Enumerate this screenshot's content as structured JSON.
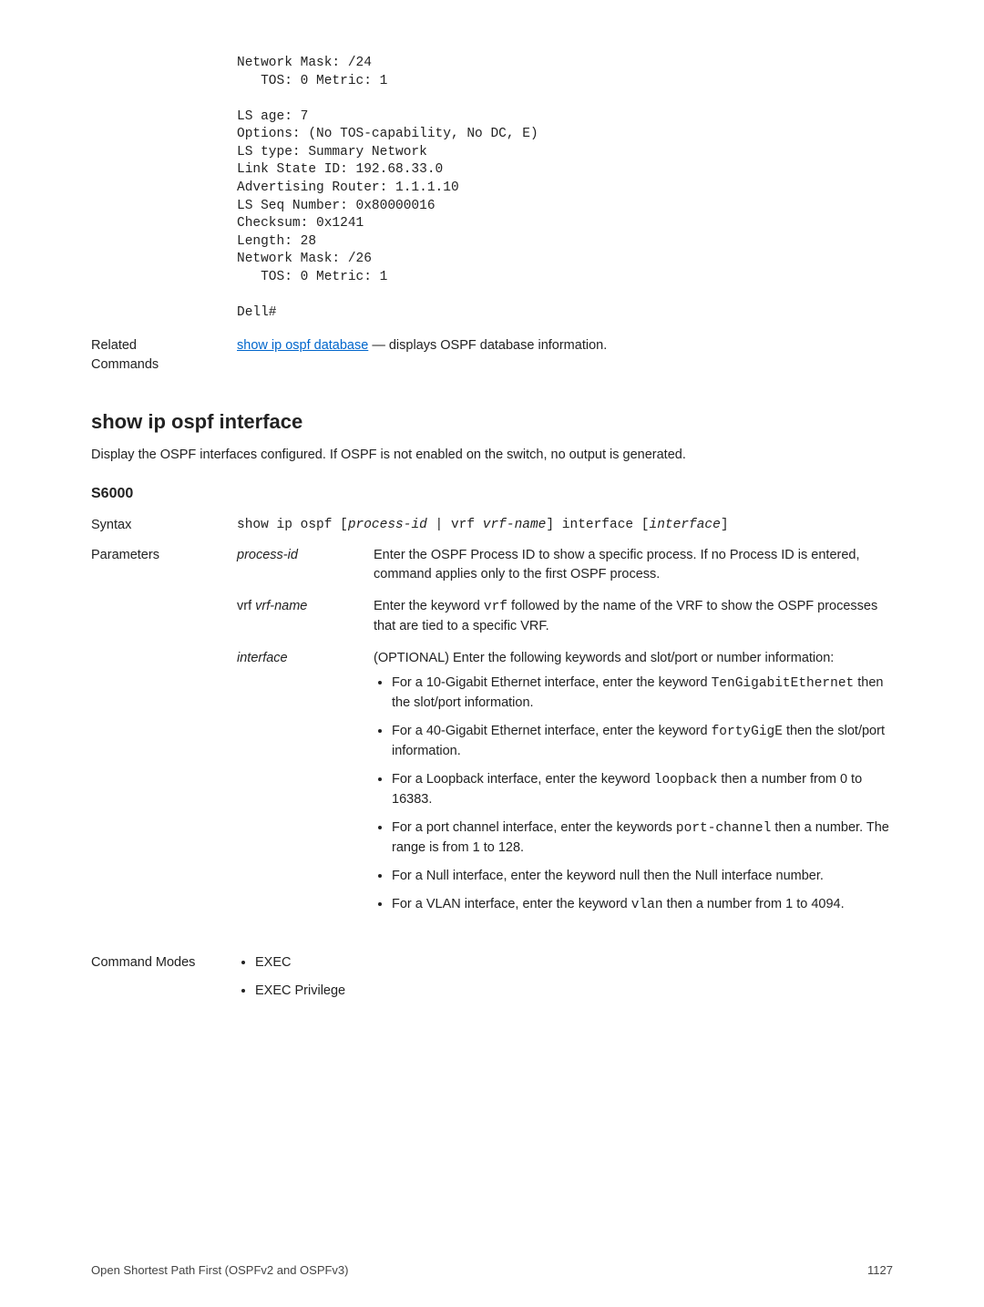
{
  "code_output": "Network Mask: /24\n   TOS: 0 Metric: 1\n\nLS age: 7\nOptions: (No TOS-capability, No DC, E)\nLS type: Summary Network\nLink State ID: 192.68.33.0\nAdvertising Router: 1.1.1.10\nLS Seq Number: 0x80000016\nChecksum: 0x1241\nLength: 28\nNetwork Mask: /26\n   TOS: 0 Metric: 1\n\nDell#",
  "related": {
    "label": "Related Commands",
    "link_text": "show ip ospf database",
    "after": " — displays OSPF database information."
  },
  "section": {
    "heading": "show ip ospf interface",
    "desc": "Display the OSPF interfaces configured. If OSPF is not enabled on the switch, no output is generated.",
    "model": "S6000"
  },
  "syntax": {
    "label": "Syntax",
    "pre": "show ip ospf [",
    "ital1": "process-id",
    "mid1": " | vrf ",
    "ital2": "vrf-name",
    "mid2": "] interface [",
    "ital3": "interface",
    "post": "]"
  },
  "params": {
    "label": "Parameters",
    "p1": {
      "name": "process-id",
      "desc": "Enter the OSPF Process ID to show a specific process. If no Process ID is entered, command applies only to the first OSPF process."
    },
    "p2": {
      "name_prefix": "vrf ",
      "name_ital": "vrf-name",
      "desc_pre": "Enter the keyword ",
      "code": "vrf",
      "desc_post": " followed by the name of the VRF to show the OSPF processes that are tied to a specific VRF."
    },
    "p3": {
      "name": "interface",
      "intro": "(OPTIONAL) Enter the following keywords and slot/port or number information:",
      "b1_pre": "For a 10-Gigabit Ethernet interface, enter the keyword ",
      "b1_code": "TenGigabitEthernet",
      "b1_post": " then the slot/port information.",
      "b2_pre": "For a 40-Gigabit Ethernet interface, enter the keyword ",
      "b2_code": "fortyGigE",
      "b2_post": " then the slot/port information.",
      "b3_pre": "For a Loopback interface, enter the keyword ",
      "b3_code": "loopback",
      "b3_post": " then a number from 0 to 16383.",
      "b4_pre": "For a port channel interface, enter the keywords ",
      "b4_code": "port-channel",
      "b4_post": " then a number. The range is from 1 to 128.",
      "b5": "For a Null interface, enter the keyword null then the Null interface number.",
      "b6_pre": "For a VLAN interface, enter the keyword ",
      "b6_code": "vlan",
      "b6_post": " then a number from 1 to 4094."
    }
  },
  "modes": {
    "label": "Command Modes",
    "m1": "EXEC",
    "m2": "EXEC Privilege"
  },
  "footer": {
    "left": "Open Shortest Path First (OSPFv2 and OSPFv3)",
    "right": "1127"
  }
}
